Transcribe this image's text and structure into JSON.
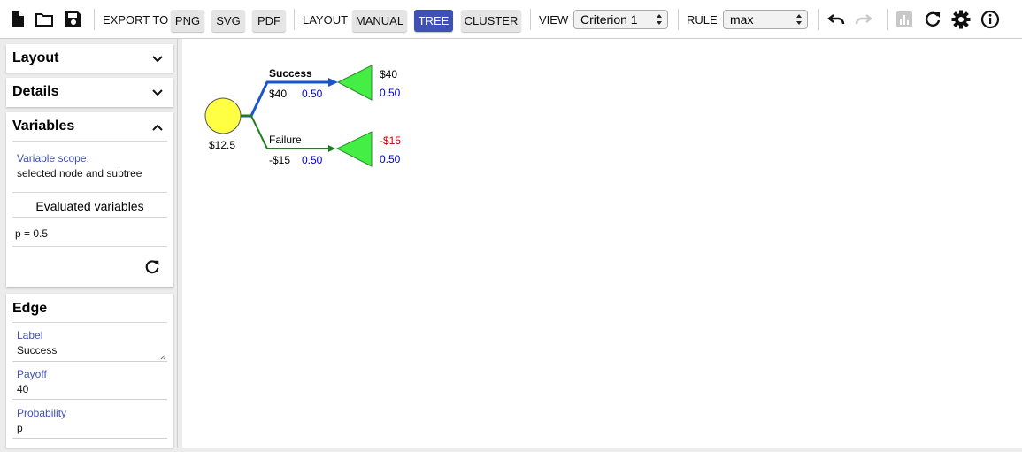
{
  "toolbar": {
    "new_icon": "new-file-icon",
    "open_icon": "folder-open-icon",
    "save_icon": "save-icon",
    "export_label": "EXPORT TO",
    "png_label": "PNG",
    "svg_label": "SVG",
    "pdf_label": "PDF",
    "layout_label": "LAYOUT",
    "manual_label": "MANUAL",
    "tree_label": "TREE",
    "cluster_label": "CLUSTER",
    "view_label": "VIEW",
    "view_value": "Criterion 1",
    "rule_label": "RULE",
    "rule_value": "max",
    "undo_icon": "undo-icon",
    "redo_icon": "redo-icon",
    "chart_icon": "bar-chart-icon",
    "recompute_icon": "refresh-icon",
    "settings_icon": "gear-icon",
    "info_icon": "info-icon",
    "active_color": "#3f51b5"
  },
  "sidebar": {
    "layout_title": "Layout",
    "details_title": "Details",
    "variables_title": "Variables",
    "variable_scope_label": "Variable scope:",
    "variable_scope_value": "selected node and subtree",
    "evaluated_label": "Evaluated variables",
    "evaluated_value": "p = 0.5",
    "edge_title": "Edge",
    "edge_fields": {
      "label_caption": "Label",
      "label_value": "Success",
      "payoff_caption": "Payoff",
      "payoff_value": "40",
      "probability_caption": "Probability",
      "probability_value": "p"
    }
  },
  "tree": {
    "chance_node_value": "$12.5",
    "branches": [
      {
        "label": "Success",
        "payoff": "$40",
        "probability": "0.50",
        "terminal_payoff": "$40",
        "terminal_probability": "0.50",
        "color": "#1a56c9",
        "payoff_color": "#000000"
      },
      {
        "label": "Failure",
        "payoff": "-$15",
        "probability": "0.50",
        "terminal_payoff": "-$15",
        "terminal_probability": "0.50",
        "color": "#1e7b1e",
        "payoff_color": "#cc0000"
      }
    ],
    "chance_fill": "#ffff44",
    "terminal_fill": "#44ee44",
    "probability_color": "#0000cc"
  }
}
